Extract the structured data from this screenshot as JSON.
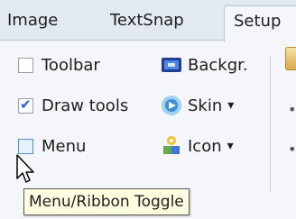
{
  "tabs": [
    {
      "label": "Image",
      "active": false
    },
    {
      "label": "TextSnap",
      "active": false
    },
    {
      "label": "Setup",
      "active": true
    }
  ],
  "checkboxes": [
    {
      "label": "Toolbar",
      "checked": false
    },
    {
      "label": "Draw tools",
      "checked": true
    },
    {
      "label": "Menu",
      "checked": false
    }
  ],
  "commands": [
    {
      "label": "Backgr.",
      "icon": "background-icon",
      "dropdown": false
    },
    {
      "label": "Skin",
      "icon": "skin-icon",
      "dropdown": true
    },
    {
      "label": "Icon",
      "icon": "icon-set-icon",
      "dropdown": true
    }
  ],
  "dropdown_arrow": "▾",
  "tooltip": "Menu/Ribbon Toggle",
  "colors": {
    "accent": "#2a5bd7",
    "tooltip_bg": "#ffffe1"
  }
}
